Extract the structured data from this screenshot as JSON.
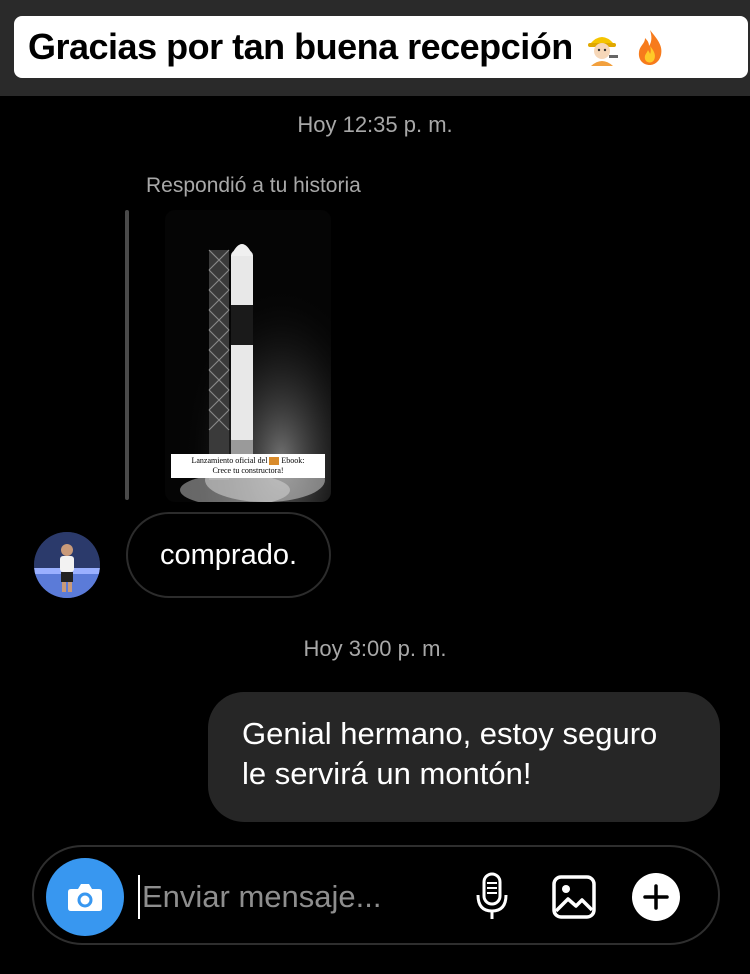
{
  "caption": {
    "text": "Gracias por tan buena recepción",
    "emojis": [
      "construction-worker-emoji",
      "fire-emoji"
    ]
  },
  "timestamps": {
    "first": "Hoy 12:35 p. m.",
    "second": "Hoy 3:00 p. m."
  },
  "story_reply": {
    "label": "Respondió a tu historia",
    "story_caption_line1": "Lanzamiento oficial del",
    "story_caption_brand": "Ebook:",
    "story_caption_line2": "Crece tu constructora!"
  },
  "messages": {
    "incoming": "comprado.",
    "outgoing_line1": "Genial hermano, estoy seguro",
    "outgoing_line2": "le servirá un montón!"
  },
  "composer": {
    "placeholder": "Enviar mensaje...",
    "icons": [
      "camera-icon",
      "microphone-icon",
      "gallery-icon",
      "add-icon"
    ]
  },
  "colors": {
    "background": "#000000",
    "banner": "#2a2a2a",
    "bubble_out": "#262626",
    "accent": "#3897f0",
    "muted_text": "#a8a8a8"
  }
}
